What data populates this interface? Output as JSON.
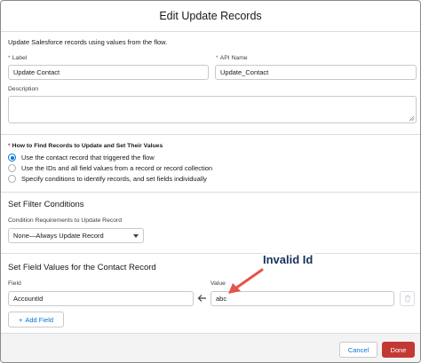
{
  "dialog": {
    "title": "Edit Update Records",
    "description": "Update Salesforce records using values from the flow."
  },
  "fields": {
    "label": {
      "label": "Label",
      "value": "Update Contact"
    },
    "api_name": {
      "label": "API Name",
      "value": "Update_Contact"
    },
    "description": {
      "label": "Description",
      "value": ""
    }
  },
  "find_records": {
    "heading": "How to Find Records to Update and Set Their Values",
    "options": [
      {
        "label": "Use the contact record that triggered the flow",
        "selected": true
      },
      {
        "label": "Use the IDs and all field values from a record or record collection",
        "selected": false
      },
      {
        "label": "Specify conditions to identify records, and set fields individually",
        "selected": false
      }
    ]
  },
  "filter": {
    "section_title": "Set Filter Conditions",
    "condition_label": "Condition Requirements to Update Record",
    "condition_value": "None—Always Update Record"
  },
  "set_values": {
    "section_title": "Set Field Values for the Contact Record",
    "field_col": "Field",
    "value_col": "Value",
    "row": {
      "field": "AccountId",
      "value": "abc"
    },
    "add_field_label": "Add Field"
  },
  "annotation": {
    "text": "Invalid Id",
    "color": "#16325c",
    "arrow_color": "#e8524a"
  },
  "footer": {
    "cancel": "Cancel",
    "done": "Done"
  },
  "colors": {
    "brand": "#0176d3",
    "destructive": "#c23934",
    "required": "#c23934"
  }
}
